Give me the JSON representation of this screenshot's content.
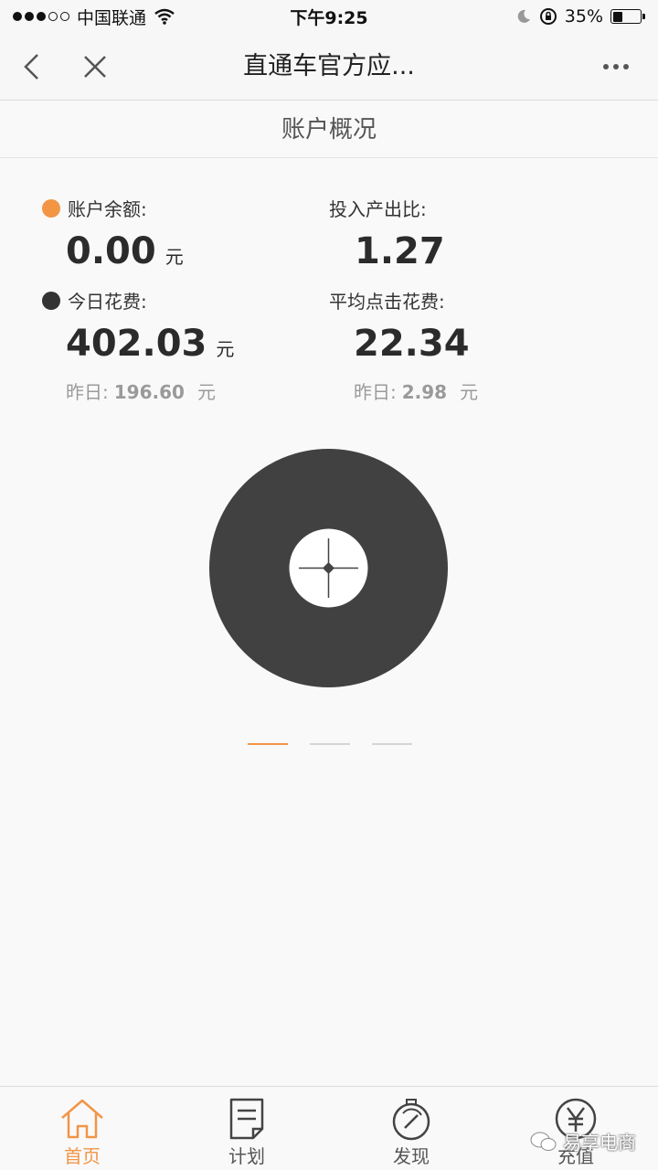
{
  "status_bar": {
    "carrier": "中国联通",
    "time": "下午9:25",
    "battery_percent": "35%",
    "battery_level": 0.35
  },
  "nav": {
    "title": "直通车官方应..."
  },
  "section": {
    "title": "账户概况"
  },
  "stats": {
    "balance": {
      "label": "账户余额:",
      "value": "0.00",
      "unit": "元",
      "dot_color": "#f29545"
    },
    "roi": {
      "label": "投入产出比:",
      "value": "1.27"
    },
    "today_cost": {
      "label": "今日花费:",
      "value": "402.03",
      "unit": "元",
      "dot_color": "#333333",
      "yesterday_label": "昨日:",
      "yesterday_value": "196.60",
      "yesterday_unit": "元"
    },
    "avg_click_cost": {
      "label": "平均点击花费:",
      "value": "22.34",
      "yesterday_label": "昨日:",
      "yesterday_value": "2.98",
      "yesterday_unit": "元"
    }
  },
  "chart": {
    "ring_color": "#414141",
    "center_color": "#ffffff"
  },
  "pager": {
    "count": 3,
    "active": 0,
    "active_color": "#f29545"
  },
  "tabs": [
    {
      "label": "首页",
      "icon": "home-icon",
      "active": true
    },
    {
      "label": "计划",
      "icon": "document-icon",
      "active": false
    },
    {
      "label": "发现",
      "icon": "compass-icon",
      "active": false
    },
    {
      "label": "充值",
      "icon": "yuan-icon",
      "active": false
    }
  ],
  "watermark": {
    "text": "易享电商"
  },
  "colors": {
    "accent": "#f29545",
    "dark": "#333333"
  }
}
